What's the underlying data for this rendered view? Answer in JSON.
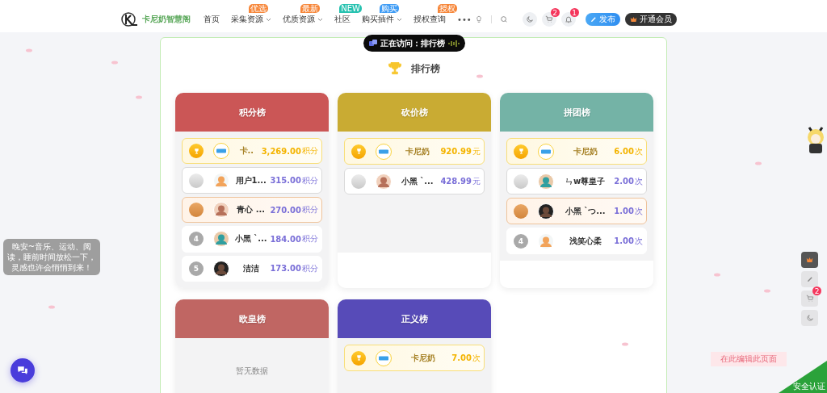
{
  "header": {
    "logo_text": "卡尼奶智慧阁",
    "nav": [
      {
        "label": "首页",
        "dropdown": false
      },
      {
        "label": "采集资源",
        "badge": "优选",
        "color": "#f7873a",
        "dropdown": true
      },
      {
        "label": "优质资源",
        "badge": "最新",
        "color": "#f7873a",
        "dropdown": true
      },
      {
        "label": "社区",
        "badge": "NEW",
        "color": "#27c2b0",
        "dropdown": false
      },
      {
        "label": "购买插件",
        "badge": "购买",
        "color": "#3f9cf5",
        "dropdown": true
      },
      {
        "label": "授权查询",
        "badge": "授权",
        "color": "#f7873a",
        "dropdown": false
      }
    ],
    "more": "•••",
    "cart_count": "2",
    "notice_count": "1",
    "publish_button": "发布",
    "vip_button": "开通会员"
  },
  "visiting": "正在访问：排行榜",
  "page_title": "排行榜",
  "boards": [
    {
      "title": "积分榜",
      "color": "#cb5656",
      "rows": [
        {
          "kind": "gold",
          "name": "卡..",
          "value": "3,269.00",
          "unit": "积分"
        },
        {
          "kind": "silver",
          "name": "用户1...",
          "value": "315.00",
          "unit": "积分"
        },
        {
          "kind": "bronze",
          "name": "青心 ...",
          "value": "270.00",
          "unit": "积分"
        },
        {
          "kind": "plain",
          "rank": "4",
          "name": "小黑 `...",
          "value": "184.00",
          "unit": "积分"
        },
        {
          "kind": "plain",
          "rank": "5",
          "name": "洁洁",
          "value": "173.00",
          "unit": "积分"
        }
      ]
    },
    {
      "title": "砍价榜",
      "color": "#c9ab33",
      "rows": [
        {
          "kind": "gold",
          "name": "卡尼奶",
          "value": "920.99",
          "unit": "元"
        },
        {
          "kind": "silver",
          "name": "小黑 `...",
          "value": "428.99",
          "unit": "元"
        }
      ]
    },
    {
      "title": "拼团榜",
      "color": "#74b3a6",
      "rows": [
        {
          "kind": "gold",
          "name": "卡尼奶",
          "value": "6.00",
          "unit": "次"
        },
        {
          "kind": "silver",
          "name": "ㄣw尊皇子",
          "value": "2.00",
          "unit": "次"
        },
        {
          "kind": "bronze",
          "name": "小黑 `つ...",
          "value": "1.00",
          "unit": "次"
        },
        {
          "kind": "plain",
          "rank": "4",
          "name": "浅笑心柔",
          "value": "1.00",
          "unit": "次"
        }
      ]
    },
    {
      "title": "欧皇榜",
      "color": "#c06663",
      "empty_text": "暂无数据"
    },
    {
      "title": "正义榜",
      "color": "#574bb8",
      "rows": [
        {
          "kind": "gold",
          "name": "卡尼奶",
          "value": "7.00",
          "unit": "次"
        }
      ]
    }
  ],
  "side_tip": "晚安~音乐、运动、阅读，睡前时间放松一下，灵感也许会悄悄到来！",
  "side_cart_count": "2",
  "edit_hint": "在此编辑此页面",
  "security_badge": "安全认证"
}
